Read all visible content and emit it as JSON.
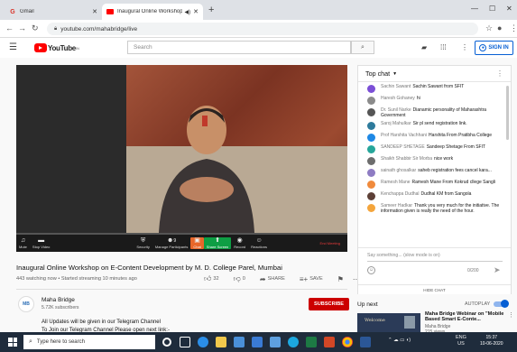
{
  "browser": {
    "tabs": [
      {
        "label": "Gmail",
        "icon": "gmail-icon"
      },
      {
        "label": "Inaugural Online Workshop",
        "icon": "youtube-icon",
        "active": true
      }
    ],
    "url": "youtube.com/mahabridge/live"
  },
  "youtube": {
    "logo": "YouTube",
    "logo_region": "IN",
    "search_placeholder": "Search",
    "sign_in": "SIGN IN"
  },
  "video": {
    "zoom_controls": [
      {
        "icon": "mic-icon",
        "label": "Mute"
      },
      {
        "icon": "camera-icon",
        "label": "Stop Video"
      },
      {
        "icon": "shield-icon",
        "label": "Security"
      },
      {
        "icon": "participants-icon",
        "label": "Manage Participants"
      },
      {
        "icon": "chat-icon",
        "label": "Chat"
      },
      {
        "icon": "share-icon",
        "label": "Share Screen"
      },
      {
        "icon": "record-icon",
        "label": "Record"
      },
      {
        "icon": "reactions-icon",
        "label": "Reactions"
      }
    ],
    "participants_count": "9",
    "end_meeting": "End Meeting",
    "title": "Inaugural Online Workshop on E-Content Development by M. D. College Parel, Mumbai",
    "meta": "443 watching now • Started streaming 10 minutes ago",
    "likes": "32",
    "dislikes": "0",
    "share_label": "SHARE",
    "save_label": "SAVE"
  },
  "channel": {
    "name": "Maha Bridge",
    "subscribers": "5.72K subscribers",
    "subscribe": "SUBSCRIBE",
    "avatar_text": "MB",
    "description_lines": [
      "All Updates will be given in our Telegram Channel",
      "To Join our Telegram Channel Please open next link:-"
    ]
  },
  "chat": {
    "header": "Top chat",
    "messages": [
      {
        "author": "Sachin Sawant",
        "text": "Sachin Sawant from SFIT",
        "color": "#7b4fd6"
      },
      {
        "author": "Haresh Gohaney",
        "text": "hi",
        "color": "#8b8b8b"
      },
      {
        "author": "Dr. Sunil Narke",
        "text": "Dianamic personality of Maharashtra Government",
        "color": "#555555"
      },
      {
        "author": "Saroj Mahulkar",
        "text": "Sir pl send registration link.",
        "color": "#2e7b9c"
      },
      {
        "author": "Prof Harshita Vachhani",
        "text": "Harshita From Pratibha College",
        "color": "#1e88e5"
      },
      {
        "author": "SANDEEP SHETAGE",
        "text": "Sandeep Shetage From SFIT",
        "color": "#26a69a"
      },
      {
        "author": "Shaikh Shabbir Sir Morba",
        "text": "nice work",
        "color": "#6d6d6d"
      },
      {
        "author": "sainath ghosalkar",
        "text": "saheb registration fees cancel kara...",
        "color": "#8e7cc3"
      },
      {
        "author": "Ramesh Mane",
        "text": "Ramesh Mane From Kokrud cllege Sangli",
        "color": "#f08a3c"
      },
      {
        "author": "Kenchappa Dudhal",
        "text": "Dudhal KM from Sangola",
        "color": "#5d4037"
      },
      {
        "author": "Sameer Hadkar",
        "text": "Thank you very much for the initiative. The information given is really the need of the hour.",
        "color": "#f4a53c"
      }
    ],
    "input_placeholder": "Say something... (slow mode is on)",
    "char_count": "0/200",
    "hide_chat": "HIDE CHAT"
  },
  "upnext": {
    "label": "Up next",
    "autoplay": "AUTOPLAY",
    "thumb_text": "Welcome",
    "title": "Maha Bridge Webinar on \"Mobile Based Smart E-Conte...",
    "channel": "Maha Bridge",
    "views": "215 views"
  },
  "taskbar": {
    "search_placeholder": "Type here to search",
    "lang": "ENG",
    "region": "US",
    "time": "15:37",
    "date": "10-06-2020"
  }
}
